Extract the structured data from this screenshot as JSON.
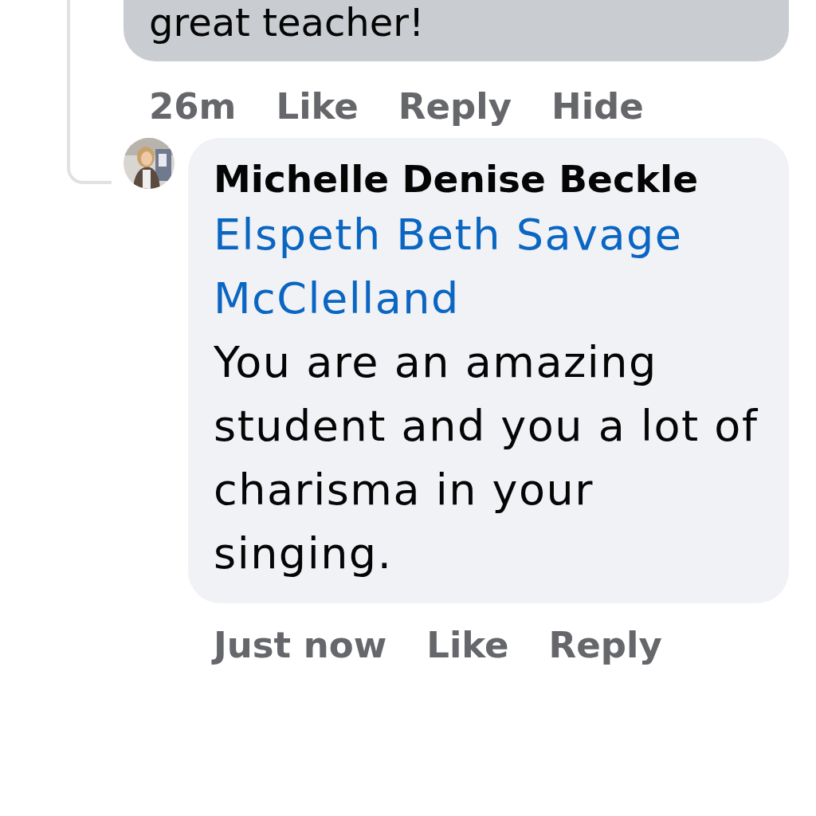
{
  "previous_comment": {
    "text": "great teacher!",
    "actions": [
      {
        "label": "26m"
      },
      {
        "label": "Like"
      },
      {
        "label": "Reply"
      },
      {
        "label": "Hide"
      }
    ]
  },
  "reply": {
    "author": "Michelle Denise Beckle",
    "mention": "Elspeth Beth Savage McClelland",
    "text": "You are an amazing student and you a lot of charisma in your singing.",
    "actions": [
      {
        "label": "Just now"
      },
      {
        "label": "Like"
      },
      {
        "label": "Reply"
      }
    ]
  }
}
